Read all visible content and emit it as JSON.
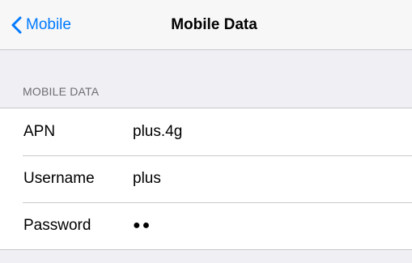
{
  "navbar": {
    "back_label": "Mobile",
    "back_icon": "chevron-left-icon",
    "title": "Mobile Data",
    "accent_color": "#007aff"
  },
  "section": {
    "header": "MOBILE DATA"
  },
  "rows": [
    {
      "label": "APN",
      "value": "plus.4g"
    },
    {
      "label": "Username",
      "value": "plus"
    },
    {
      "label": "Password",
      "value": "●●"
    }
  ]
}
